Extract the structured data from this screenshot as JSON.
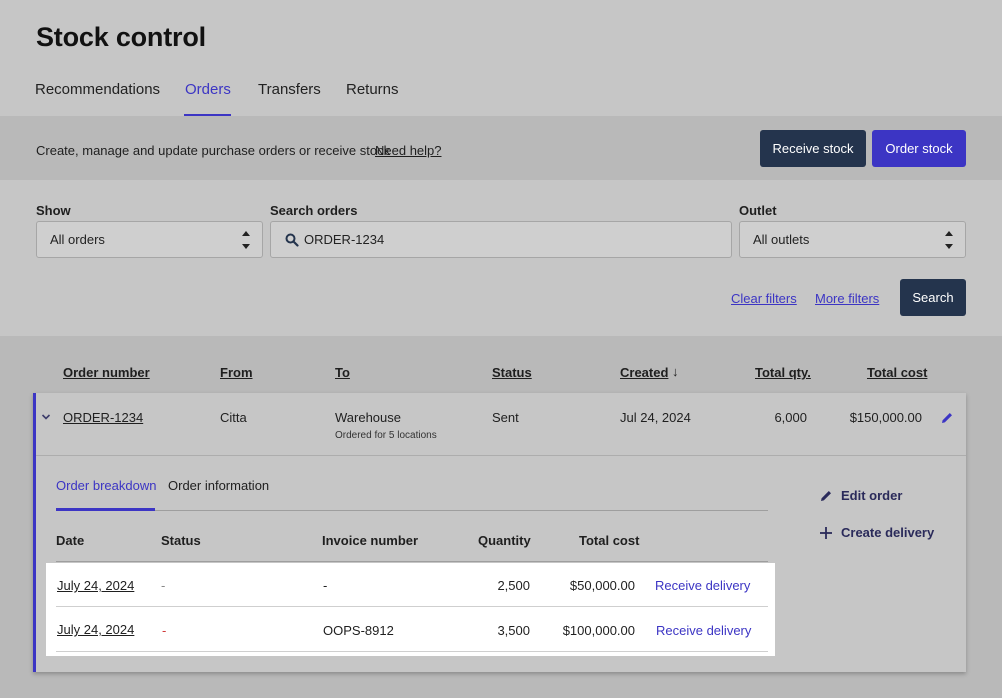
{
  "page": {
    "title": "Stock control"
  },
  "tabs": [
    {
      "label": "Recommendations"
    },
    {
      "label": "Orders",
      "active": true
    },
    {
      "label": "Transfers"
    },
    {
      "label": "Returns"
    }
  ],
  "action_bar": {
    "description": "Create, manage and update purchase orders or receive stock",
    "help_link": "Need help?",
    "receive_stock": "Receive stock",
    "order_stock": "Order stock"
  },
  "filters": {
    "show_label": "Show",
    "show_value": "All orders",
    "search_label": "Search orders",
    "search_value": "ORDER-1234",
    "outlet_label": "Outlet",
    "outlet_value": "All outlets",
    "clear_filters": "Clear filters",
    "more_filters": "More filters",
    "search_button": "Search"
  },
  "table": {
    "headers": {
      "order_number": "Order number",
      "from": "From",
      "to": "To",
      "status": "Status",
      "created": "Created",
      "sort_indicator": "↓",
      "total_qty": "Total qty.",
      "total_cost": "Total cost"
    },
    "order": {
      "order_number": "ORDER-1234",
      "from": "Citta",
      "to": "Warehouse",
      "to_note": "Ordered for 5 locations",
      "status": "Sent",
      "created": "Jul 24, 2024",
      "total_qty": "6,000",
      "total_cost": "$150,000.00"
    }
  },
  "detail": {
    "tabs": [
      {
        "label": "Order breakdown",
        "active": true
      },
      {
        "label": "Order information"
      }
    ],
    "actions": {
      "edit_order": "Edit order",
      "create_delivery": "Create delivery"
    },
    "headers": {
      "date": "Date",
      "status": "Status",
      "invoice_number": "Invoice number",
      "quantity": "Quantity",
      "total_cost": "Total cost"
    },
    "rows": [
      {
        "date": "July 24, 2024",
        "status": "-",
        "invoice_number": "-",
        "quantity": "2,500",
        "total_cost": "$50,000.00",
        "action": "Receive delivery"
      },
      {
        "date": "July 24, 2024",
        "status": "-",
        "invoice_number": "OOPS-8912",
        "quantity": "3,500",
        "total_cost": "$100,000.00",
        "action": "Receive delivery"
      }
    ]
  },
  "colors": {
    "accent": "#3c35c4",
    "dark_button": "#24344d",
    "overlay_background": "#c6c6c6",
    "status_red": "#d03a3a"
  }
}
